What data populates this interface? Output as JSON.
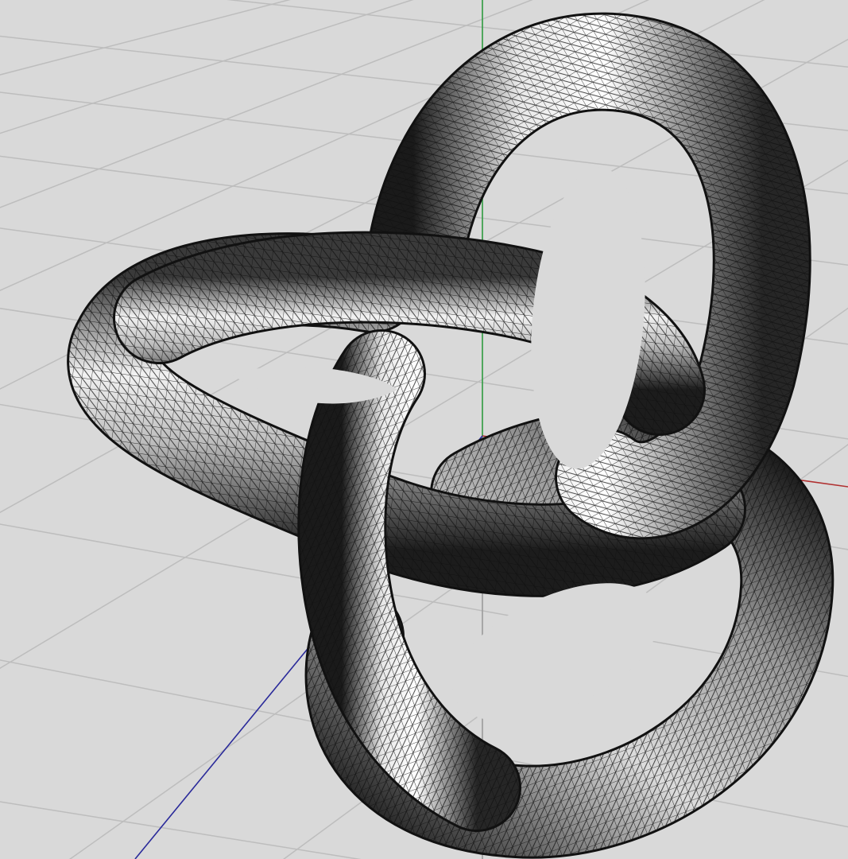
{
  "viewport": {
    "view": "perspective",
    "shading": "wireframe-over-shaded",
    "object": "trefoil-knot-mesh"
  },
  "colors": {
    "background": "#d9d9d9",
    "grid_line": "#bdbdbd",
    "grid_line_major": "#9a9a9a",
    "axis_x": "#b03030",
    "axis_y": "#2e9a3e",
    "axis_z": "#2a2a9a",
    "mesh_edge": "#111111",
    "mesh_fill_light": "#ffffff",
    "mesh_fill_dark": "#1a1a1a"
  }
}
